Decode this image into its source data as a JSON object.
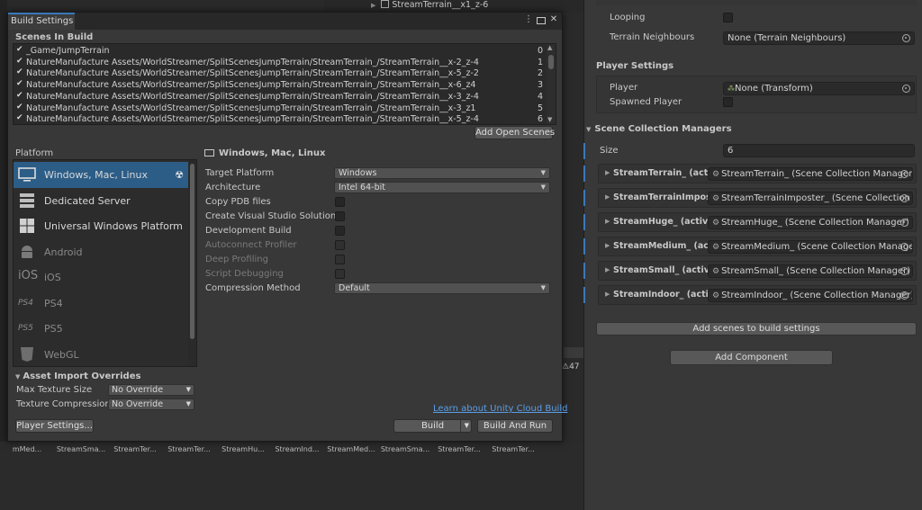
{
  "background": {
    "hierarchy_item": "StreamTerrain__x1_z-6",
    "count_label": "47",
    "assets": [
      "mMed...",
      "StreamSma...",
      "StreamTer...",
      "StreamTer...",
      "StreamHu...",
      "StreamInd...",
      "StreamMed...",
      "StreamSma...",
      "StreamTer...",
      "StreamTer..."
    ]
  },
  "inspector": {
    "looping_label": "Looping",
    "terrain_neighbours_label": "Terrain Neighbours",
    "terrain_neighbours_value": "None (Terrain Neighbours)",
    "player_settings_title": "Player Settings",
    "player_label": "Player",
    "player_value": "None (Transform)",
    "spawned_player_label": "Spawned Player",
    "scm_title": "Scene Collection Managers",
    "size_label": "Size",
    "size_value": "6",
    "collections": [
      {
        "name": "StreamTerrain_ (active)",
        "value": "StreamTerrain_ (Scene Collection Manager)"
      },
      {
        "name": "StreamTerrainImposter_ (active)",
        "value": "StreamTerrainImposter_ (Scene Collection Manager)"
      },
      {
        "name": "StreamHuge_ (active)",
        "value": "StreamHuge_ (Scene Collection Manager)"
      },
      {
        "name": "StreamMedium_ (active)",
        "value": "StreamMedium_ (Scene Collection Manager)"
      },
      {
        "name": "StreamSmall_ (active)",
        "value": "StreamSmall_ (Scene Collection Manager)"
      },
      {
        "name": "StreamIndoor_ (active)",
        "value": "StreamIndoor_ (Scene Collection Manager)"
      }
    ],
    "add_scenes_button": "Add scenes to build settings",
    "add_component_button": "Add Component"
  },
  "build_settings": {
    "tab_title": "Build Settings",
    "scenes_in_build_title": "Scenes In Build",
    "scenes": [
      {
        "path": "_Game/JumpTerrain",
        "index": "0"
      },
      {
        "path": "NatureManufacture Assets/WorldStreamer/SplitScenesJumpTerrain/StreamTerrain_/StreamTerrain__x-2_z-4",
        "index": "1"
      },
      {
        "path": "NatureManufacture Assets/WorldStreamer/SplitScenesJumpTerrain/StreamTerrain_/StreamTerrain__x-5_z-2",
        "index": "2"
      },
      {
        "path": "NatureManufacture Assets/WorldStreamer/SplitScenesJumpTerrain/StreamTerrain_/StreamTerrain__x-6_z4",
        "index": "3"
      },
      {
        "path": "NatureManufacture Assets/WorldStreamer/SplitScenesJumpTerrain/StreamTerrain_/StreamTerrain__x-3_z-4",
        "index": "4"
      },
      {
        "path": "NatureManufacture Assets/WorldStreamer/SplitScenesJumpTerrain/StreamTerrain_/StreamTerrain__x-3_z1",
        "index": "5"
      },
      {
        "path": "NatureManufacture Assets/WorldStreamer/SplitScenesJumpTerrain/StreamTerrain_/StreamTerrain__x-5_z-4",
        "index": "6"
      }
    ],
    "add_open_scenes_button": "Add Open Scenes",
    "platform_title": "Platform",
    "platforms": [
      {
        "label": "Windows, Mac, Linux",
        "icon": "monitor-icon"
      },
      {
        "label": "Dedicated Server",
        "icon": "server-icon"
      },
      {
        "label": "Universal Windows Platform",
        "icon": "windows-logo-icon"
      },
      {
        "label": "Android",
        "icon": "android-icon"
      },
      {
        "label": "iOS",
        "icon": "ios-icon"
      },
      {
        "label": "PS4",
        "icon": "ps4-icon"
      },
      {
        "label": "PS5",
        "icon": "ps5-icon"
      },
      {
        "label": "WebGL",
        "icon": "html5-icon"
      }
    ],
    "details_title": "Windows, Mac, Linux",
    "settings": {
      "target_platform_label": "Target Platform",
      "target_platform_value": "Windows",
      "architecture_label": "Architecture",
      "architecture_value": "Intel 64-bit",
      "copy_pdb_label": "Copy PDB files",
      "create_vs_label": "Create Visual Studio Solution",
      "dev_build_label": "Development Build",
      "autoconnect_label": "Autoconnect Profiler",
      "deep_profiling_label": "Deep Profiling",
      "script_debugging_label": "Script Debugging",
      "compression_label": "Compression Method",
      "compression_value": "Default"
    },
    "asset_import_title": "Asset Import Overrides",
    "max_texture_label": "Max Texture Size",
    "max_texture_value": "No Override",
    "texture_compression_label": "Texture Compression",
    "texture_compression_value": "No Override",
    "cloud_link": "Learn about Unity Cloud Build",
    "player_settings_button": "Player Settings...",
    "build_button": "Build",
    "build_and_run_button": "Build And Run"
  }
}
